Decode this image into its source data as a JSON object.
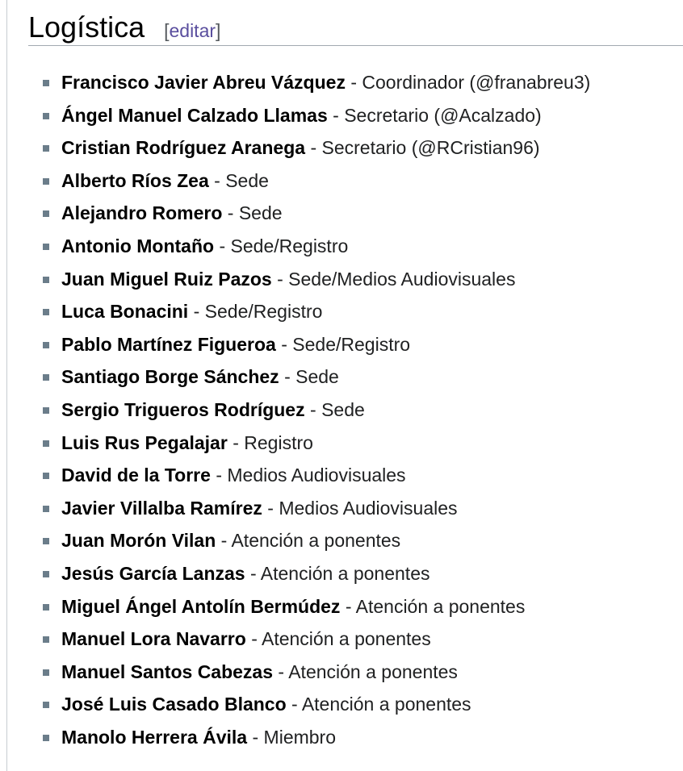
{
  "section": {
    "title": "Logística",
    "edit_open": "[",
    "edit_label": "editar",
    "edit_close": "]"
  },
  "members": [
    {
      "name": "Francisco Javier Abreu Vázquez",
      "role": "Coordinador (@franabreu3)"
    },
    {
      "name": "Ángel Manuel Calzado Llamas",
      "role": "Secretario (@Acalzado)"
    },
    {
      "name": "Cristian Rodríguez Aranega",
      "role": "Secretario (@RCristian96)"
    },
    {
      "name": "Alberto Ríos Zea",
      "role": "Sede"
    },
    {
      "name": "Alejandro Romero",
      "role": "Sede"
    },
    {
      "name": "Antonio Montaño",
      "role": "Sede/Registro"
    },
    {
      "name": "Juan Miguel Ruiz Pazos",
      "role": "Sede/Medios Audiovisuales"
    },
    {
      "name": "Luca Bonacini",
      "role": "Sede/Registro"
    },
    {
      "name": "Pablo Martínez Figueroa",
      "role": "Sede/Registro"
    },
    {
      "name": "Santiago Borge Sánchez",
      "role": "Sede"
    },
    {
      "name": "Sergio Trigueros Rodríguez",
      "role": "Sede"
    },
    {
      "name": "Luis Rus Pegalajar",
      "role": "Registro"
    },
    {
      "name": "David de la Torre",
      "role": "Medios Audiovisuales"
    },
    {
      "name": "Javier Villalba Ramírez",
      "role": "Medios Audiovisuales"
    },
    {
      "name": "Juan Morón Vilan",
      "role": "Atención a ponentes"
    },
    {
      "name": "Jesús García Lanzas",
      "role": "Atención a ponentes"
    },
    {
      "name": "Miguel Ángel Antolín Bermúdez",
      "role": "Atención a ponentes"
    },
    {
      "name": "Manuel Lora Navarro",
      "role": "Atención a ponentes"
    },
    {
      "name": "Manuel Santos Cabezas",
      "role": "Atención a ponentes"
    },
    {
      "name": "José Luis Casado Blanco",
      "role": "Atención a ponentes"
    },
    {
      "name": "Manolo Herrera Ávila",
      "role": "Miembro"
    }
  ],
  "separator": "-",
  "colors": {
    "link": "#5a4e9e",
    "bullet": "#6b7d8a",
    "heading_rule": "#a2a9b1"
  }
}
